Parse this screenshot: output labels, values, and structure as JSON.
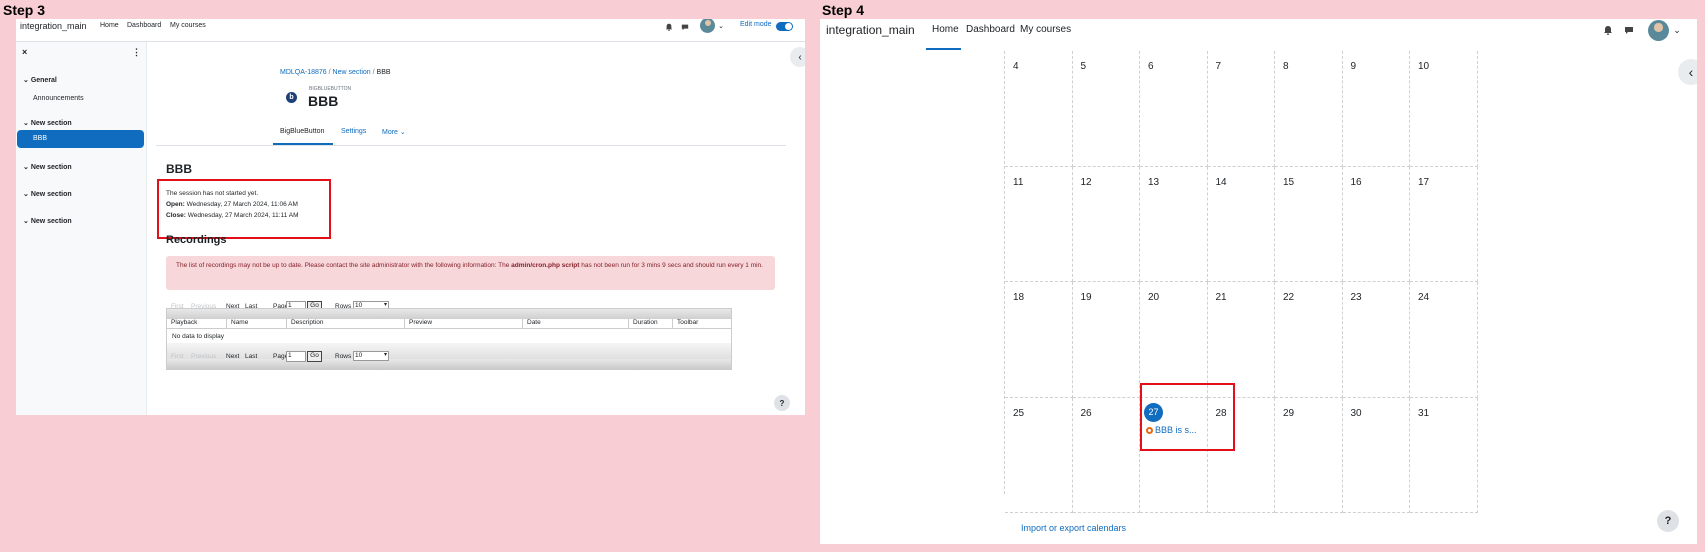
{
  "step3": {
    "label": "Step 3",
    "brand": "integration_main",
    "nav": [
      "Home",
      "Dashboard",
      "My courses"
    ],
    "edit_mode": "Edit mode",
    "sidebar": {
      "sections": [
        {
          "title": "General",
          "items": [
            "Announcements"
          ]
        },
        {
          "title": "New section",
          "items": [
            "BBB"
          ]
        },
        {
          "title": "New section",
          "items": []
        },
        {
          "title": "New section",
          "items": []
        },
        {
          "title": "New section",
          "items": []
        }
      ]
    },
    "breadcrumb": [
      "MDLQA-18876",
      "New section",
      "BBB"
    ],
    "module_type": "BIGBLUEBUTTON",
    "title": "BBB",
    "tabs": [
      "BigBlueButton",
      "Settings",
      "More"
    ],
    "heading": "BBB",
    "session_text": "The session has not started yet.",
    "open_label": "Open:",
    "open_value": "Wednesday, 27 March 2024, 11:06 AM",
    "close_label": "Close:",
    "close_value": "Wednesday, 27 March 2024, 11:11 AM",
    "recordings_heading": "Recordings",
    "alert_pre": "The list of recordings may not be up to date. Please contact the site administrator with the following information: The ",
    "alert_bold": "admin/cron.php script",
    "alert_post": " has not been run for 3 mins 9 secs and should run every 1 min.",
    "pager": {
      "first": "First",
      "previous": "Previous",
      "next": "Next",
      "last": "Last",
      "page": "Page",
      "page_value": "1",
      "go": "Go",
      "rows": "Rows",
      "rows_value": "10"
    },
    "columns": [
      "Playback",
      "Name",
      "Description",
      "Preview",
      "Date",
      "Duration",
      "Toolbar"
    ],
    "no_data": "No data to display"
  },
  "step4": {
    "label": "Step 4",
    "brand": "integration_main",
    "nav": [
      "Home",
      "Dashboard",
      "My courses"
    ],
    "weeks": [
      [
        "4",
        "5",
        "6",
        "7",
        "8",
        "9",
        "10"
      ],
      [
        "11",
        "12",
        "13",
        "14",
        "15",
        "16",
        "17"
      ],
      [
        "18",
        "19",
        "20",
        "21",
        "22",
        "23",
        "24"
      ],
      [
        "25",
        "26",
        "27",
        "28",
        "29",
        "30",
        "31"
      ]
    ],
    "today": "27",
    "event": "BBB is s...",
    "import_link": "Import or export calendars"
  },
  "colors": {
    "accent": "#0f6cbf",
    "highlight": "#e3101a",
    "background": "#f8cdd3"
  }
}
